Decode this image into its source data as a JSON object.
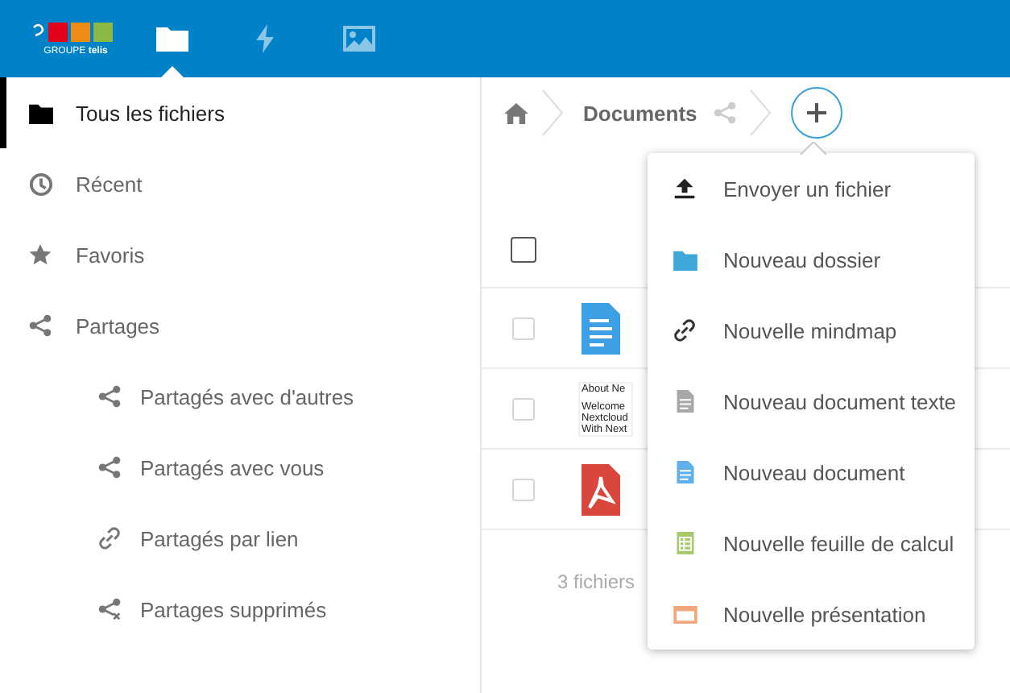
{
  "header": {
    "logo_text": "GROUPE **telis**",
    "apps": [
      {
        "kind": "files",
        "selected": true
      },
      {
        "kind": "activity",
        "selected": false
      },
      {
        "kind": "gallery",
        "selected": false
      }
    ]
  },
  "sidebar": {
    "items": [
      {
        "label": "Tous les fichiers",
        "kind": "folder",
        "selected": true
      },
      {
        "label": "Récent",
        "kind": "clock",
        "selected": false
      },
      {
        "label": "Favoris",
        "kind": "star",
        "selected": false
      },
      {
        "label": "Partages",
        "kind": "share",
        "selected": false,
        "children": [
          {
            "label": "Partagés avec d'autres",
            "kind": "share",
            "selected": false
          },
          {
            "label": "Partagés avec vous",
            "kind": "share",
            "selected": false
          },
          {
            "label": "Partagés par lien",
            "kind": "link",
            "selected": false
          },
          {
            "label": "Partages supprimés",
            "kind": "share-deleted",
            "selected": false
          }
        ]
      }
    ]
  },
  "breadcrumb": {
    "folder": "Documents"
  },
  "files": {
    "select_all": {
      "checked": false
    },
    "rows": [
      {
        "kind": "text",
        "checked": false
      },
      {
        "kind": "preview",
        "checked": false,
        "preview_lines": [
          "About Ne",
          "Welcome",
          "Nextcloud",
          "With Next"
        ]
      },
      {
        "kind": "pdf",
        "checked": false
      }
    ],
    "summary": "3 fichiers"
  },
  "new_menu": {
    "items": [
      {
        "label": "Envoyer un fichier",
        "kind": "upload"
      },
      {
        "label": "Nouveau dossier",
        "kind": "folder"
      },
      {
        "label": "Nouvelle mindmap",
        "kind": "link"
      },
      {
        "label": "Nouveau document texte",
        "kind": "textfile"
      },
      {
        "label": "Nouveau document",
        "kind": "document"
      },
      {
        "label": "Nouvelle feuille de calcul",
        "kind": "spreadsheet"
      },
      {
        "label": "Nouvelle présentation",
        "kind": "presentation"
      }
    ]
  }
}
